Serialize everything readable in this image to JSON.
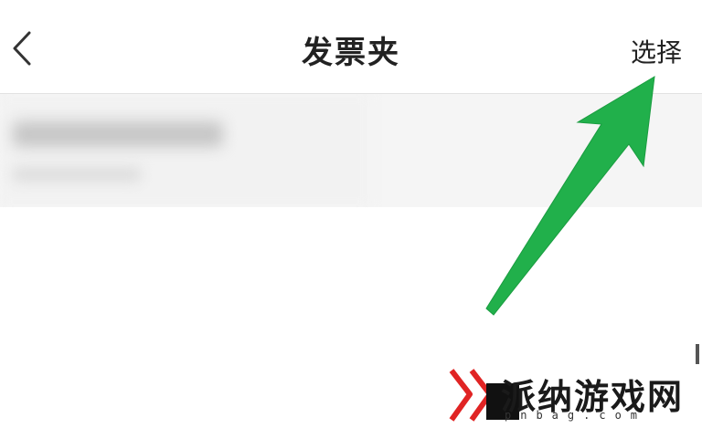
{
  "header": {
    "title": "发票夹",
    "select_label": "选择"
  },
  "card": {
    "blurred": true
  },
  "watermark": {
    "text": "派纳游戏网",
    "url": "pnbag.com"
  },
  "colors": {
    "accent_arrow": "#21b04b",
    "title_text": "#222222",
    "card_bg": "#f5f5f5",
    "watermark_red": "#e02424"
  },
  "icons": {
    "back": "chevron-left-icon",
    "annotation": "green-arrow-icon"
  }
}
